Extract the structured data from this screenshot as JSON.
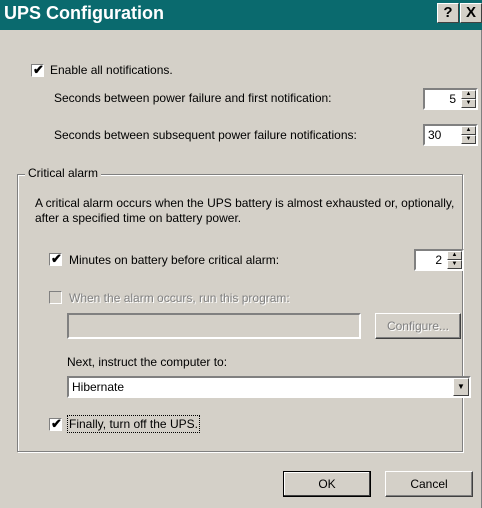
{
  "window": {
    "title": "UPS Configuration",
    "help_glyph": "?",
    "close_glyph": "X"
  },
  "notifications": {
    "enable_label": "Enable all notifications.",
    "enable_checked": true,
    "first_label": "Seconds between power failure and first notification:",
    "first_value": "5",
    "subsequent_label": "Seconds between subsequent power failure notifications:",
    "subsequent_value": "30"
  },
  "critical": {
    "group_title": "Critical alarm",
    "description": "A critical alarm occurs when the UPS battery is almost exhausted or, optionally, after a specified time on battery power.",
    "minutes_label": "Minutes on battery before critical alarm:",
    "minutes_checked": true,
    "minutes_value": "2",
    "run_program_label": "When the alarm occurs, run this program:",
    "run_program_checked": false,
    "program_path": "",
    "configure_label": "Configure...",
    "next_label": "Next, instruct the computer to:",
    "next_value": "Hibernate",
    "turn_off_label": "Finally, turn off the UPS.",
    "turn_off_checked": true
  },
  "buttons": {
    "ok": "OK",
    "cancel": "Cancel"
  },
  "icons": {
    "check": "check-icon",
    "spin_up": "arrow-up-icon",
    "spin_down": "arrow-down-icon",
    "dropdown": "chevron-down-icon"
  }
}
